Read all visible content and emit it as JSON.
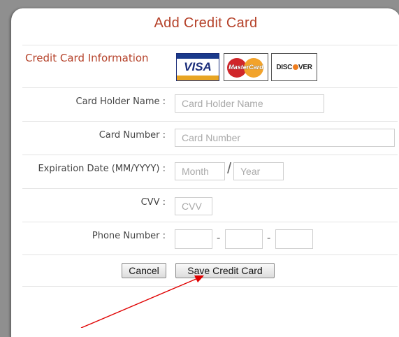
{
  "dialog": {
    "title": "Add Credit Card",
    "section_label": "Credit Card Information",
    "card_logos": {
      "visa": "VISA",
      "mastercard": "MasterCard",
      "discover_pre": "DISC",
      "discover_post": "VER"
    },
    "fields": {
      "holder_label": "Card Holder Name :",
      "holder_placeholder": "Card Holder Name",
      "number_label": "Card Number :",
      "number_placeholder": "Card Number",
      "expiry_label": "Expiration Date (MM/YYYY) :",
      "month_placeholder": "Month",
      "year_placeholder": "Year",
      "expiry_separator": "/",
      "cvv_label": "CVV :",
      "cvv_placeholder": "CVV",
      "phone_label": "Phone Number :",
      "phone_separator": "-"
    },
    "buttons": {
      "cancel": "Cancel",
      "save": "Save Credit Card"
    }
  },
  "colors": {
    "title": "#b5422a",
    "annotation_arrow": "#e00000"
  }
}
